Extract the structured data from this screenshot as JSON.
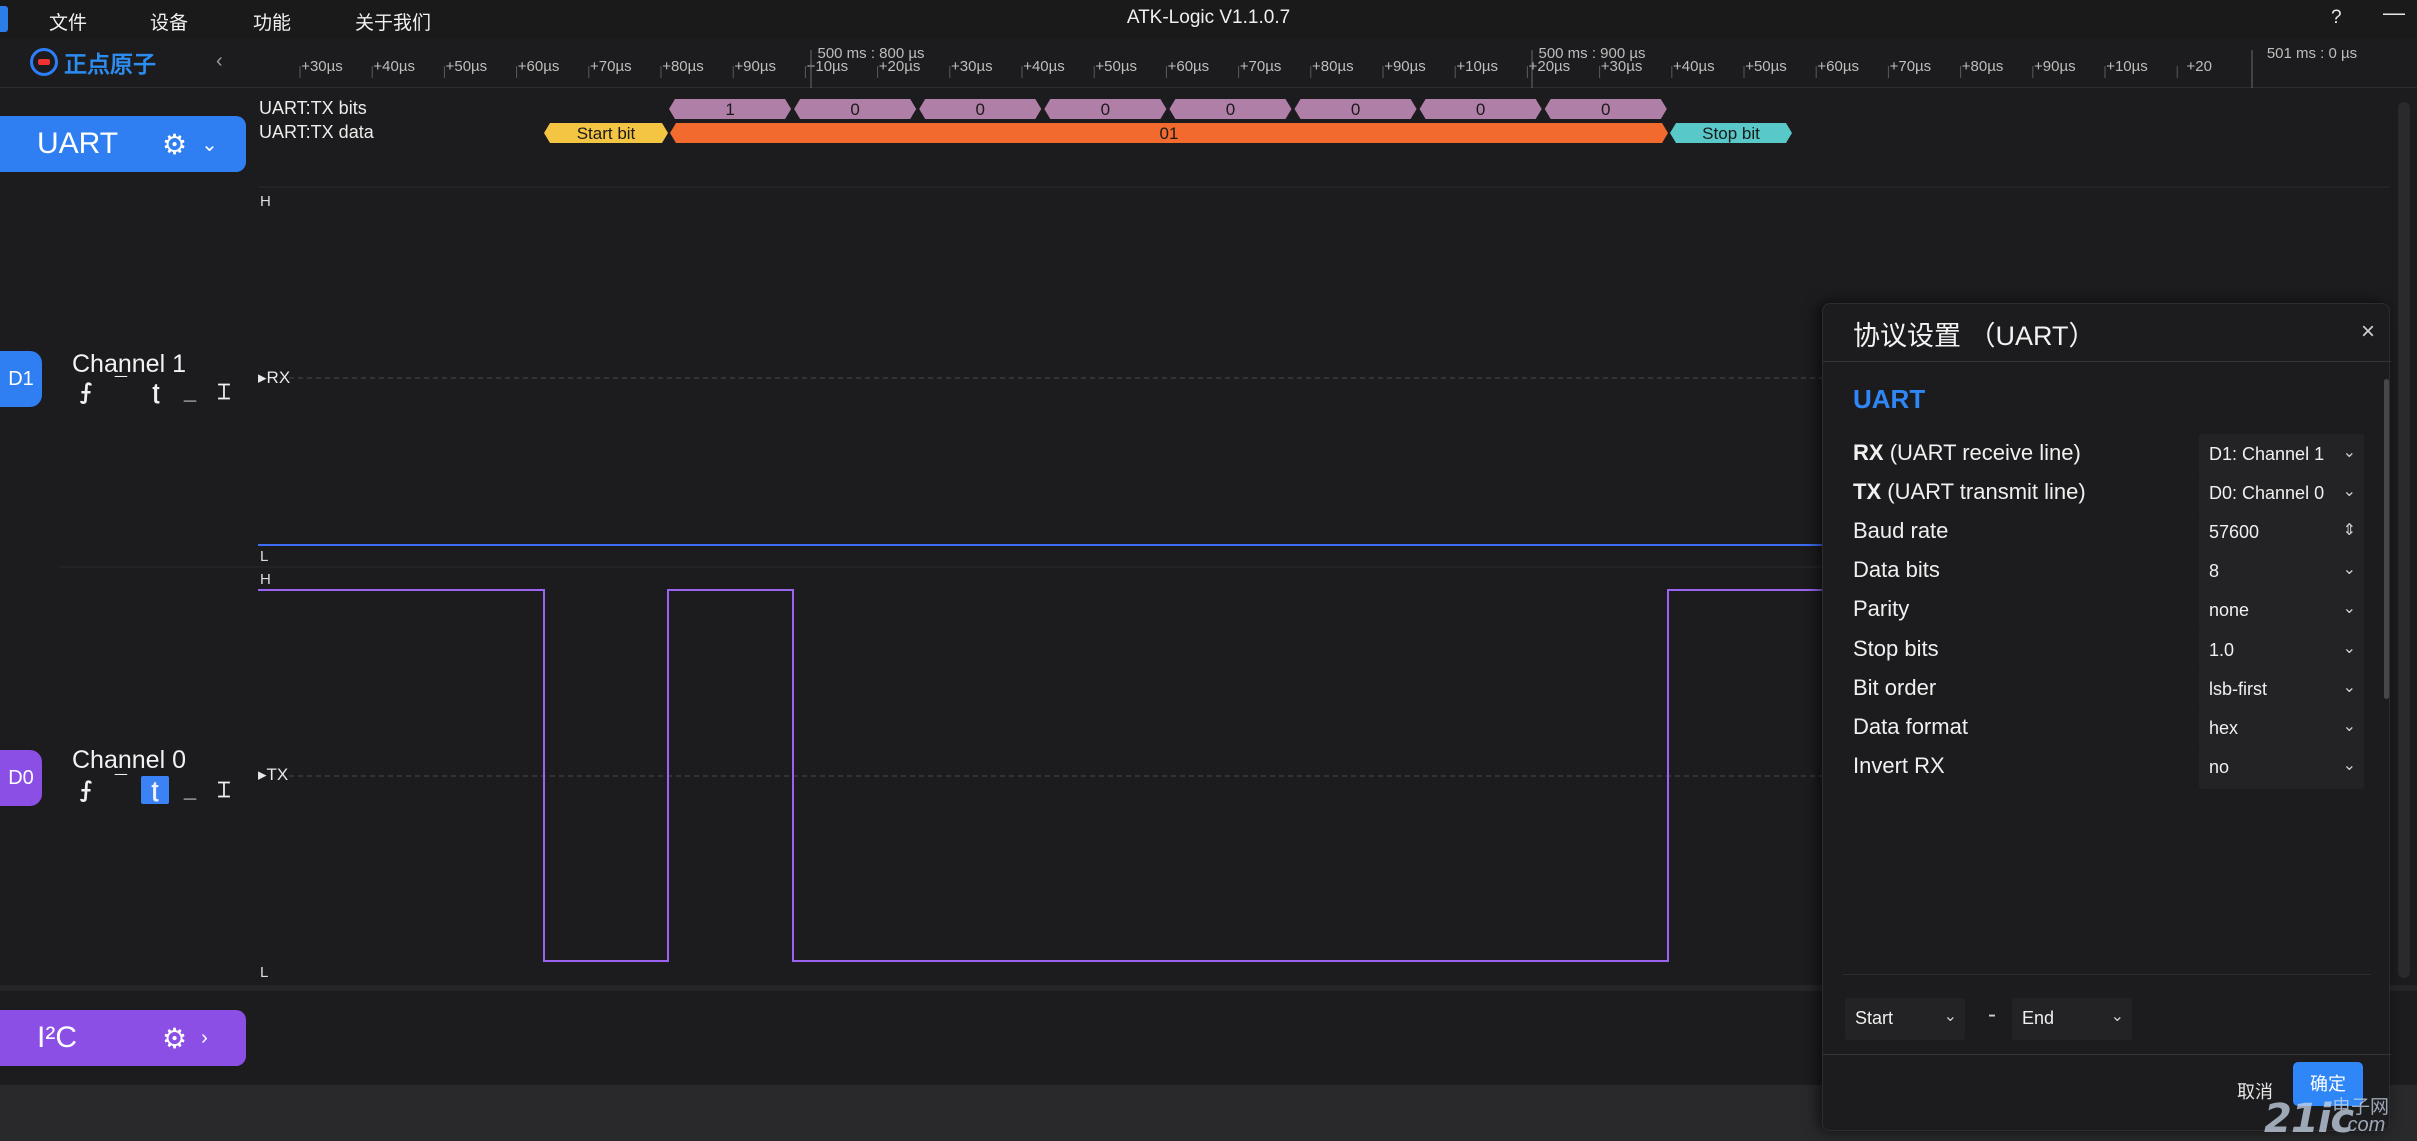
{
  "titlebar": {
    "menu": [
      "文件",
      "设备",
      "功能",
      "关于我们"
    ],
    "title": "ATK-Logic  V1.1.0.7",
    "help": "?",
    "minimize": "—"
  },
  "brand": {
    "text": "正点原子"
  },
  "ruler": {
    "ticks": [
      "+30µs",
      "+40µs",
      "+50µs",
      "+60µs",
      "+70µs",
      "+80µs",
      "+90µs",
      "+10µs",
      "+20µs",
      "+30µs",
      "+40µs",
      "+50µs",
      "+60µs",
      "+70µs",
      "+80µs",
      "+90µs",
      "+10µs",
      "+20µs",
      "+30µs",
      "+40µs",
      "+50µs",
      "+60µs",
      "+70µs",
      "+80µs",
      "+90µs",
      "+10µs",
      "+20"
    ],
    "markers": [
      "500 ms : 800 µs",
      "500 ms : 900 µs",
      "501 ms : 0 µs"
    ]
  },
  "groups": {
    "uart": {
      "label": "UART",
      "gear": "⚙",
      "chevron": "⌄"
    },
    "i2c": {
      "label": "I²C",
      "gear": "⚙",
      "chevron": "›"
    }
  },
  "protocol_rows": {
    "tx_bits_label": "UART:TX bits",
    "tx_data_label": "UART:TX data",
    "bits": [
      "1",
      "0",
      "0",
      "0",
      "0",
      "0",
      "0",
      "0"
    ],
    "start_bit": "Start bit",
    "data_value": "01",
    "stop_bit": "Stop bit",
    "colors": {
      "bits": "#b07fa8",
      "start": "#f4c542",
      "data": "#f26a2e",
      "stop": "#58c8c8"
    }
  },
  "channels": {
    "d1": {
      "badge": "D1",
      "name": "Channel 1",
      "signal": "RX",
      "high": "H",
      "low": "L"
    },
    "d0": {
      "badge": "D0",
      "name": "Channel 0",
      "signal": "TX",
      "high": "H",
      "low": "L"
    },
    "trigger_icons": [
      "rising-edge",
      "high-level",
      "falling-edge",
      "low-level",
      "any-edge"
    ]
  },
  "colors": {
    "accent": "#2f86f6",
    "uart": "#2f7ff2",
    "i2c": "#8b4fe6",
    "d0_wave": "#9a63f2",
    "d1_wave": "#3d6cf5"
  },
  "dialog": {
    "title": "协议设置 （UART）",
    "close": "×",
    "section": "UART",
    "fields": [
      {
        "key": "RX",
        "label": "(UART receive line)",
        "value": "D1: Channel 1",
        "kind": "select"
      },
      {
        "key": "TX",
        "label": "(UART transmit line)",
        "value": "D0: Channel 0",
        "kind": "select"
      },
      {
        "key": "",
        "label": "Baud rate",
        "value": "57600",
        "kind": "spin"
      },
      {
        "key": "",
        "label": "Data bits",
        "value": "8",
        "kind": "select"
      },
      {
        "key": "",
        "label": "Parity",
        "value": "none",
        "kind": "select"
      },
      {
        "key": "",
        "label": "Stop bits",
        "value": "1.0",
        "kind": "select"
      },
      {
        "key": "",
        "label": "Bit order",
        "value": "lsb-first",
        "kind": "select"
      },
      {
        "key": "",
        "label": "Data format",
        "value": "hex",
        "kind": "select"
      },
      {
        "key": "",
        "label": "Invert RX",
        "value": "no",
        "kind": "select"
      }
    ],
    "range_start": "Start",
    "range_dash": "-",
    "range_end": "End",
    "cancel": "取消",
    "ok": "确定"
  },
  "watermark": {
    "big": "21ic",
    "small": "电子网",
    "com": ".com"
  }
}
